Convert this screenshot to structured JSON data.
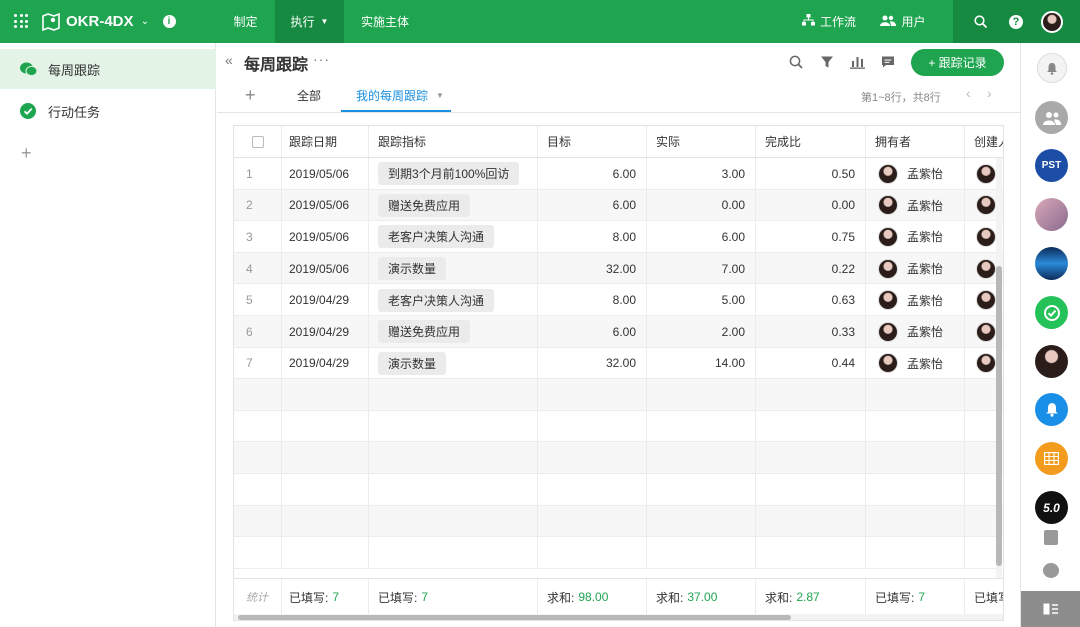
{
  "app": {
    "title": "OKR-4DX"
  },
  "topnav": {
    "items": [
      "制定",
      "执行",
      "实施主体"
    ],
    "workflow": "工作流",
    "users": "用户"
  },
  "sidebar": {
    "items": [
      {
        "label": "每周跟踪",
        "icon": "chat-bubbles-icon"
      },
      {
        "label": "行动任务",
        "icon": "check-badge-icon"
      }
    ]
  },
  "view": {
    "title": "每周跟踪",
    "tabs": [
      "全部",
      "我的每周跟踪"
    ],
    "add_record": "+ 跟踪记录",
    "pagination": "第1~8行，共8行"
  },
  "table": {
    "headers": [
      "跟踪日期",
      "跟踪指标",
      "目标",
      "实际",
      "完成比",
      "拥有者",
      "创建人"
    ],
    "rows": [
      {
        "n": "1",
        "date": "2019/05/06",
        "metric": "到期3个月前100%回访",
        "target": "6.00",
        "actual": "3.00",
        "ratio": "0.50",
        "owner": "孟紫怡"
      },
      {
        "n": "2",
        "date": "2019/05/06",
        "metric": "赠送免费应用",
        "target": "6.00",
        "actual": "0.00",
        "ratio": "0.00",
        "owner": "孟紫怡"
      },
      {
        "n": "3",
        "date": "2019/05/06",
        "metric": "老客户决策人沟通",
        "target": "8.00",
        "actual": "6.00",
        "ratio": "0.75",
        "owner": "孟紫怡"
      },
      {
        "n": "4",
        "date": "2019/05/06",
        "metric": "演示数量",
        "target": "32.00",
        "actual": "7.00",
        "ratio": "0.22",
        "owner": "孟紫怡"
      },
      {
        "n": "5",
        "date": "2019/04/29",
        "metric": "老客户决策人沟通",
        "target": "8.00",
        "actual": "5.00",
        "ratio": "0.63",
        "owner": "孟紫怡"
      },
      {
        "n": "6",
        "date": "2019/04/29",
        "metric": "赠送免费应用",
        "target": "6.00",
        "actual": "2.00",
        "ratio": "0.33",
        "owner": "孟紫怡"
      },
      {
        "n": "7",
        "date": "2019/04/29",
        "metric": "演示数量",
        "target": "32.00",
        "actual": "14.00",
        "ratio": "0.44",
        "owner": "孟紫怡"
      }
    ],
    "footer": {
      "label": "统计",
      "date": {
        "k": "已填写:",
        "v": "7"
      },
      "metric": {
        "k": "已填写:",
        "v": "7"
      },
      "target": {
        "k": "求和:",
        "v": "98.00"
      },
      "actual": {
        "k": "求和:",
        "v": "37.00"
      },
      "ratio": {
        "k": "求和:",
        "v": "2.87"
      },
      "owner": {
        "k": "已填写:",
        "v": "7"
      },
      "creator": {
        "k": "已填写:",
        "v": ""
      }
    }
  },
  "rightbar": {
    "pst": "PST",
    "version": "5.0"
  },
  "colors": {
    "brand": "#1fa450",
    "active_nav": "#178a42",
    "tab_active": "#1a8fe0"
  }
}
